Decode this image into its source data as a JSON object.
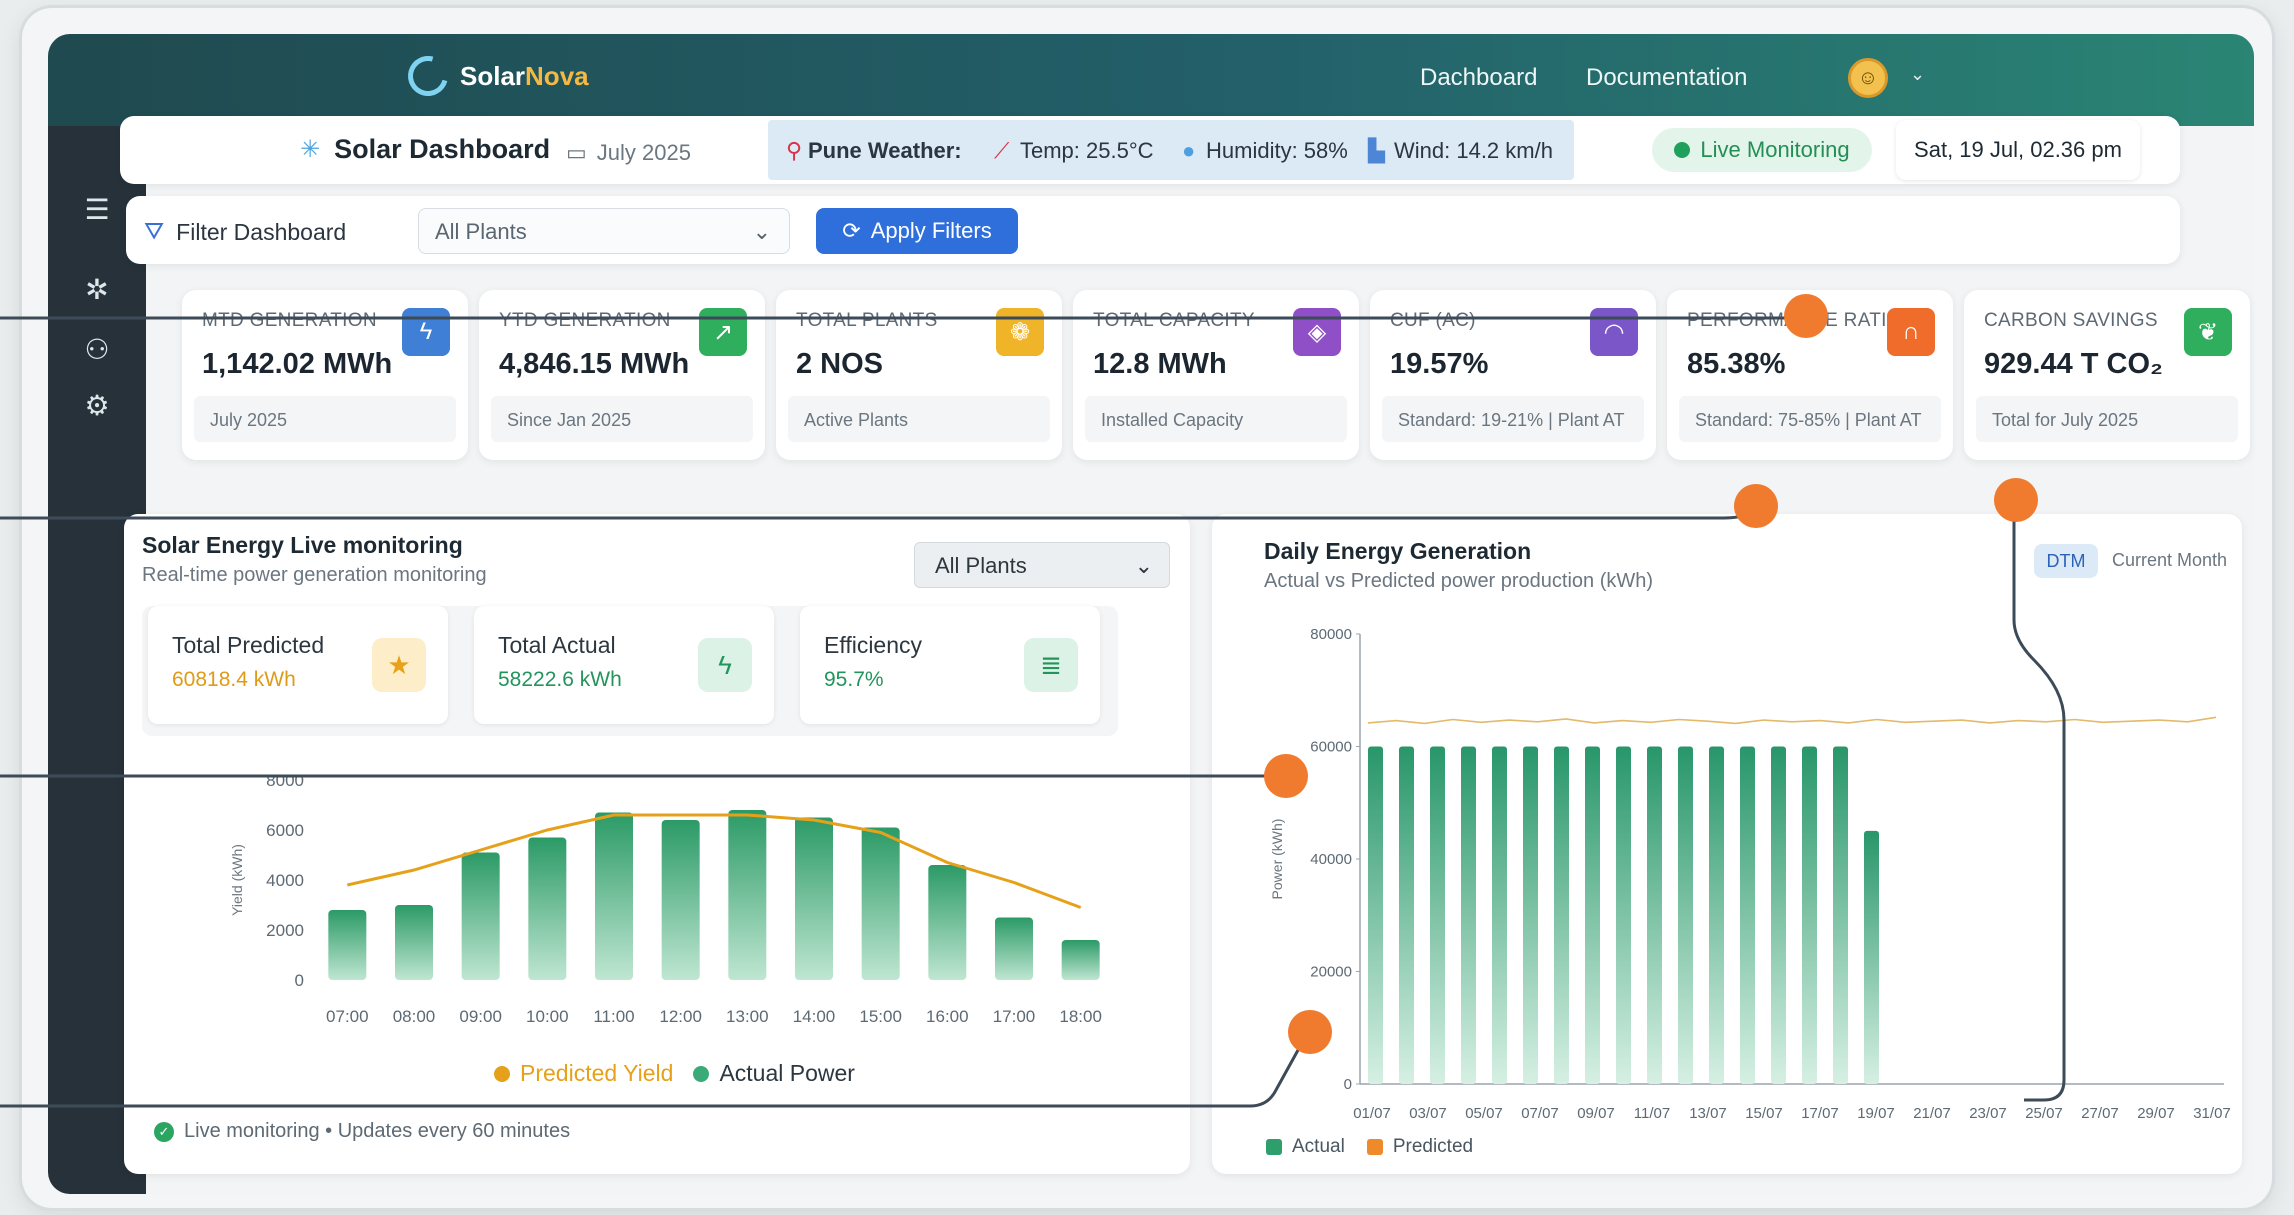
{
  "app": {
    "brand_prefix": "Solar",
    "brand_suffix": "Nova",
    "nav_dashboard": "Dachboard",
    "nav_docs": "Documentation"
  },
  "header": {
    "title": "Solar Dashboard",
    "month": "July 2025",
    "weather_label": "Pune Weather:",
    "temp": "Temp: 25.5°C",
    "humidity": "Humidity: 58%",
    "wind": "Wind: 14.2 km/h",
    "live": "Live Monitoring",
    "datetime": "Sat, 19 Jul, 02.36 pm"
  },
  "filters": {
    "label": "Filter Dashboard",
    "select_value": "All Plants",
    "apply": "Apply Filters"
  },
  "kpis": [
    {
      "label": "MTD GENERATION",
      "value": "1,142.02 MWh",
      "sub": "July 2025",
      "color": "#3f7fd6",
      "icon": "bolt-icon"
    },
    {
      "label": "YTD GENERATION",
      "value": "4,846.15 MWh",
      "sub": "Since Jan 2025",
      "color": "#2fae5d",
      "icon": "trend-up-icon"
    },
    {
      "label": "TOTAL PLANTS",
      "value": "2 NOS",
      "sub": "Active Plants",
      "color": "#f0b429",
      "icon": "plants-icon"
    },
    {
      "label": "TOTAL CAPACITY",
      "value": "12.8 MWh",
      "sub": "Installed Capacity",
      "color": "#8e4fc7",
      "icon": "capacity-icon"
    },
    {
      "label": "CUF (AC)",
      "value": "19.57%",
      "sub": "Standard: 19-21% | Plant AT",
      "color": "#7a56c8",
      "icon": "gauge-icon"
    },
    {
      "label": "PERFORMANCE RATIO",
      "value": "85.38%",
      "sub": "Standard: 75-85% | Plant AT",
      "color": "#ef6c2b",
      "icon": "performance-icon"
    },
    {
      "label": "CARBON SAVINGS",
      "value": "929.44 T CO₂",
      "sub": "Total for July 2025",
      "color": "#2fae5d",
      "icon": "leaf-icon"
    }
  ],
  "live_panel": {
    "title": "Solar Energy Live monitoring",
    "subtitle": "Real-time power generation monitoring",
    "select": "All Plants",
    "predicted_label": "Total Predicted",
    "predicted_value": "60818.4 kWh",
    "actual_label": "Total Actual",
    "actual_value": "58222.6 kWh",
    "efficiency_label": "Efficiency",
    "efficiency_value": "95.7%",
    "legend_predicted": "Predicted Yield",
    "legend_actual": "Actual Power",
    "footnote": "Live monitoring • Updates every 60 minutes"
  },
  "daily_panel": {
    "title": "Daily Energy Generation",
    "subtitle": "Actual vs Predicted power production (kWh)",
    "toggle_active": "DTM",
    "toggle_inactive": "Current Month",
    "legend_actual": "Actual",
    "legend_predicted": "Predicted"
  },
  "chart_data": [
    {
      "type": "bar",
      "title": "Solar Energy Live monitoring",
      "xlabel": "",
      "ylabel": "Yield (kWh)",
      "ylim": [
        0,
        8000
      ],
      "yticks": [
        "0",
        "2000",
        "4000",
        "6000",
        "8000"
      ],
      "categories": [
        "07:00",
        "08:00",
        "09:00",
        "10:00",
        "11:00",
        "12:00",
        "13:00",
        "14:00",
        "15:00",
        "16:00",
        "17:00",
        "18:00"
      ],
      "series": [
        {
          "name": "Actual Power",
          "type": "bar",
          "color": "#2e9e6a",
          "values": [
            2800,
            3000,
            5100,
            5700,
            6700,
            6400,
            6800,
            6500,
            6100,
            4600,
            2500,
            1600
          ]
        },
        {
          "name": "Predicted Yield",
          "type": "line",
          "color": "#e6a11a",
          "values": [
            3800,
            4400,
            5200,
            6000,
            6600,
            6600,
            6600,
            6400,
            5900,
            4700,
            3900,
            2900
          ]
        }
      ]
    },
    {
      "type": "bar",
      "title": "Daily Energy Generation",
      "xlabel": "",
      "ylabel": "Power (kWh)",
      "ylim": [
        0,
        80000
      ],
      "yticks": [
        "0",
        "20000",
        "40000",
        "60000",
        "80000"
      ],
      "categories": [
        "01/07",
        "03/07",
        "05/07",
        "07/07",
        "09/07",
        "11/07",
        "13/07",
        "15/07",
        "17/07",
        "19/07",
        "21/07",
        "23/07",
        "25/07",
        "27/07",
        "29/07",
        "31/07"
      ],
      "series": [
        {
          "name": "Actual",
          "type": "bar",
          "color": "#2e9e6a",
          "values": [
            60000,
            60000,
            60000,
            60000,
            60000,
            60000,
            60000,
            60000,
            60000,
            60000,
            60000,
            60000,
            60000,
            60000,
            60000,
            60000,
            45000
          ]
        },
        {
          "name": "Predicted",
          "type": "line",
          "color": "#e6a11a",
          "values": [
            64200,
            64600,
            64100,
            64800,
            64300,
            64700,
            64400,
            64900,
            64200,
            64600,
            64300,
            64800,
            64500,
            64100,
            64700,
            64400,
            64600,
            64200,
            64800,
            64300,
            64500,
            64700,
            64200,
            64600,
            64400,
            64800,
            64300,
            64500,
            64700,
            64400,
            65200
          ]
        }
      ]
    }
  ]
}
